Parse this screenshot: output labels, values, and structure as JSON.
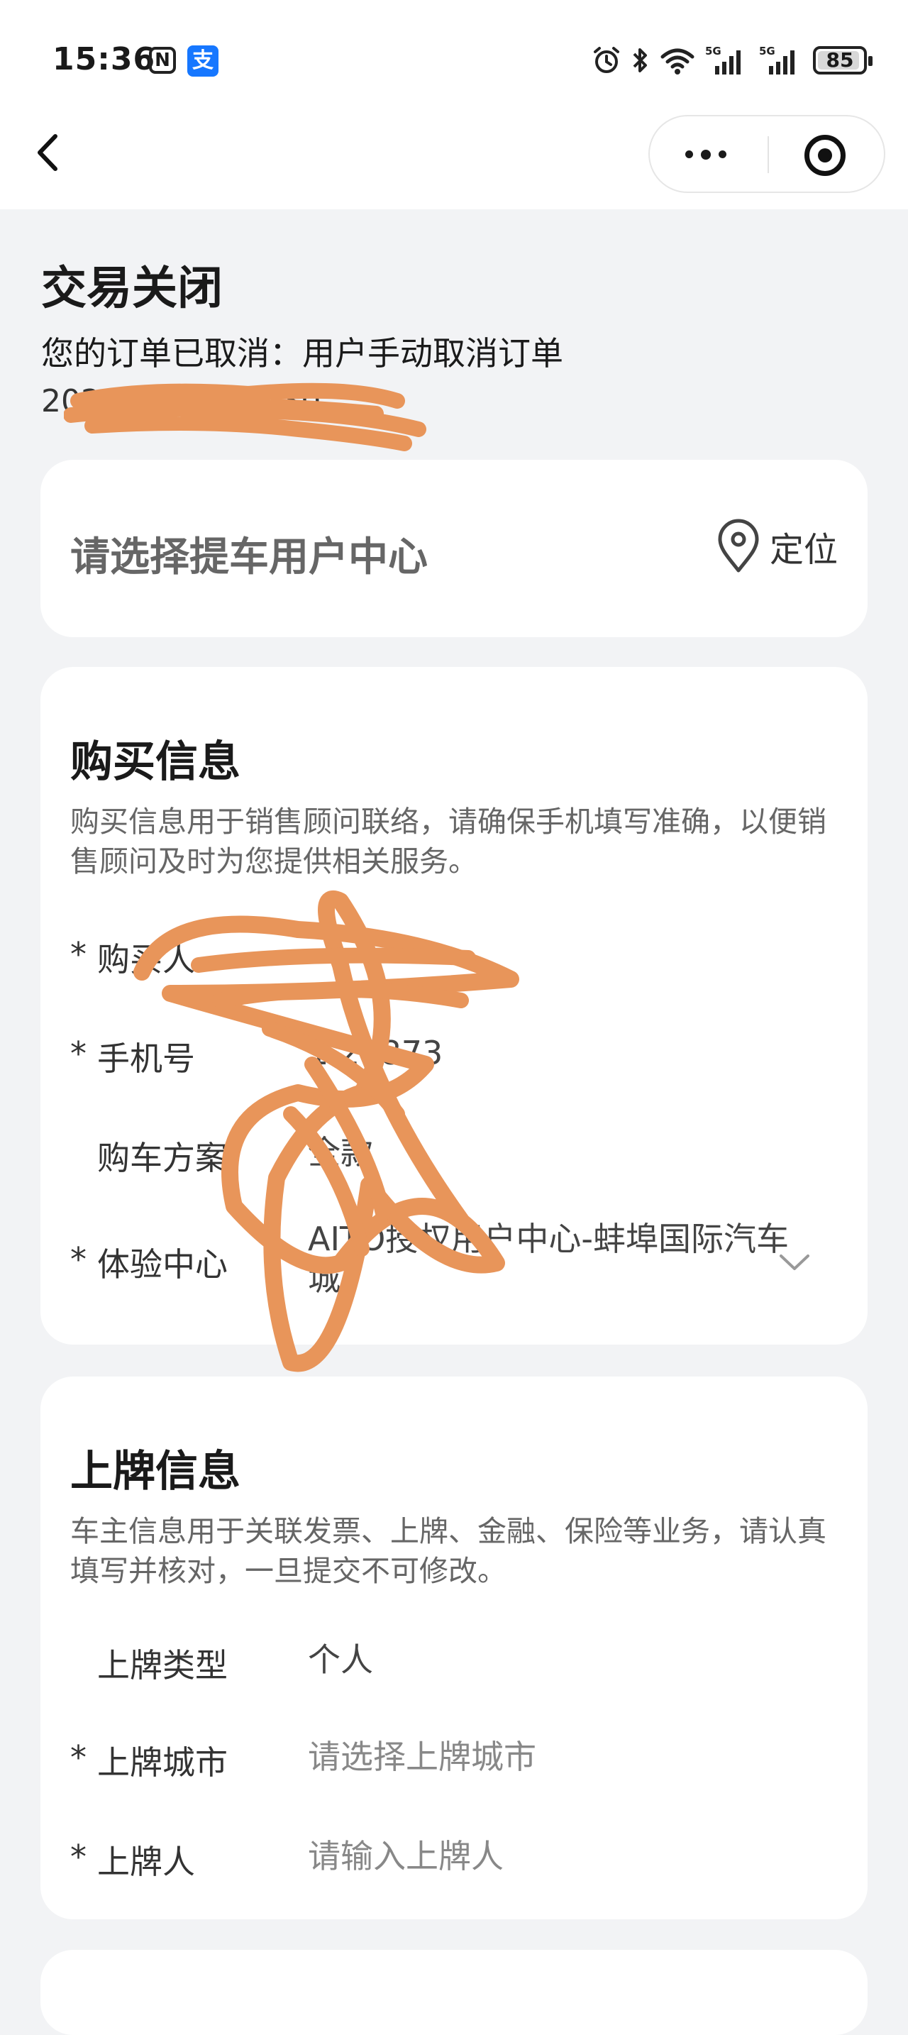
{
  "status_bar": {
    "time": "15:36",
    "nfc_glyph": "N",
    "alipay_glyph": "支",
    "network_label": "5G",
    "battery": "85",
    "icons": [
      "alarm-icon",
      "bluetooth-icon",
      "wifi-icon",
      "signal-5g-icon",
      "signal-5g-icon",
      "battery-icon"
    ]
  },
  "order": {
    "status_title": "交易关闭",
    "status_desc": "您的订单已取消：用户手动取消订单",
    "time_partial": "2025  /05 1 :33:30"
  },
  "dealer": {
    "placeholder": "请选择提车用户中心",
    "locate_label": "定位"
  },
  "purchase_info": {
    "title": "购买信息",
    "description": "购买信息用于销售顾问联络，请确保手机填写准确，以便销售顾问及时为您提供相关服务。",
    "fields": [
      {
        "required_mark": "*",
        "label": "购买人",
        "value": "  "
      },
      {
        "required_mark": "*",
        "label": "手机号",
        "value": "1     20873"
      },
      {
        "required_mark": "",
        "label": "购车方案",
        "value": "全款"
      },
      {
        "required_mark": "*",
        "label": "体验中心",
        "value": "AITO授权用户中心-蚌埠国际汽车城"
      }
    ]
  },
  "plate_info": {
    "title": "上牌信息",
    "description": "车主信息用于关联发票、上牌、金融、保险等业务，请认真填写并核对，一旦提交不可修改。",
    "fields": [
      {
        "required_mark": "",
        "label": "上牌类型",
        "value": "个人"
      },
      {
        "required_mark": "*",
        "label": "上牌城市",
        "placeholder": "请选择上牌城市"
      },
      {
        "required_mark": "*",
        "label": "上牌人",
        "placeholder": "请输入上牌人"
      }
    ]
  },
  "colors": {
    "page_bg": "#f2f3f5",
    "card_bg": "#ffffff",
    "scribble": "#e8955a",
    "alipay_blue": "#1677ff"
  }
}
